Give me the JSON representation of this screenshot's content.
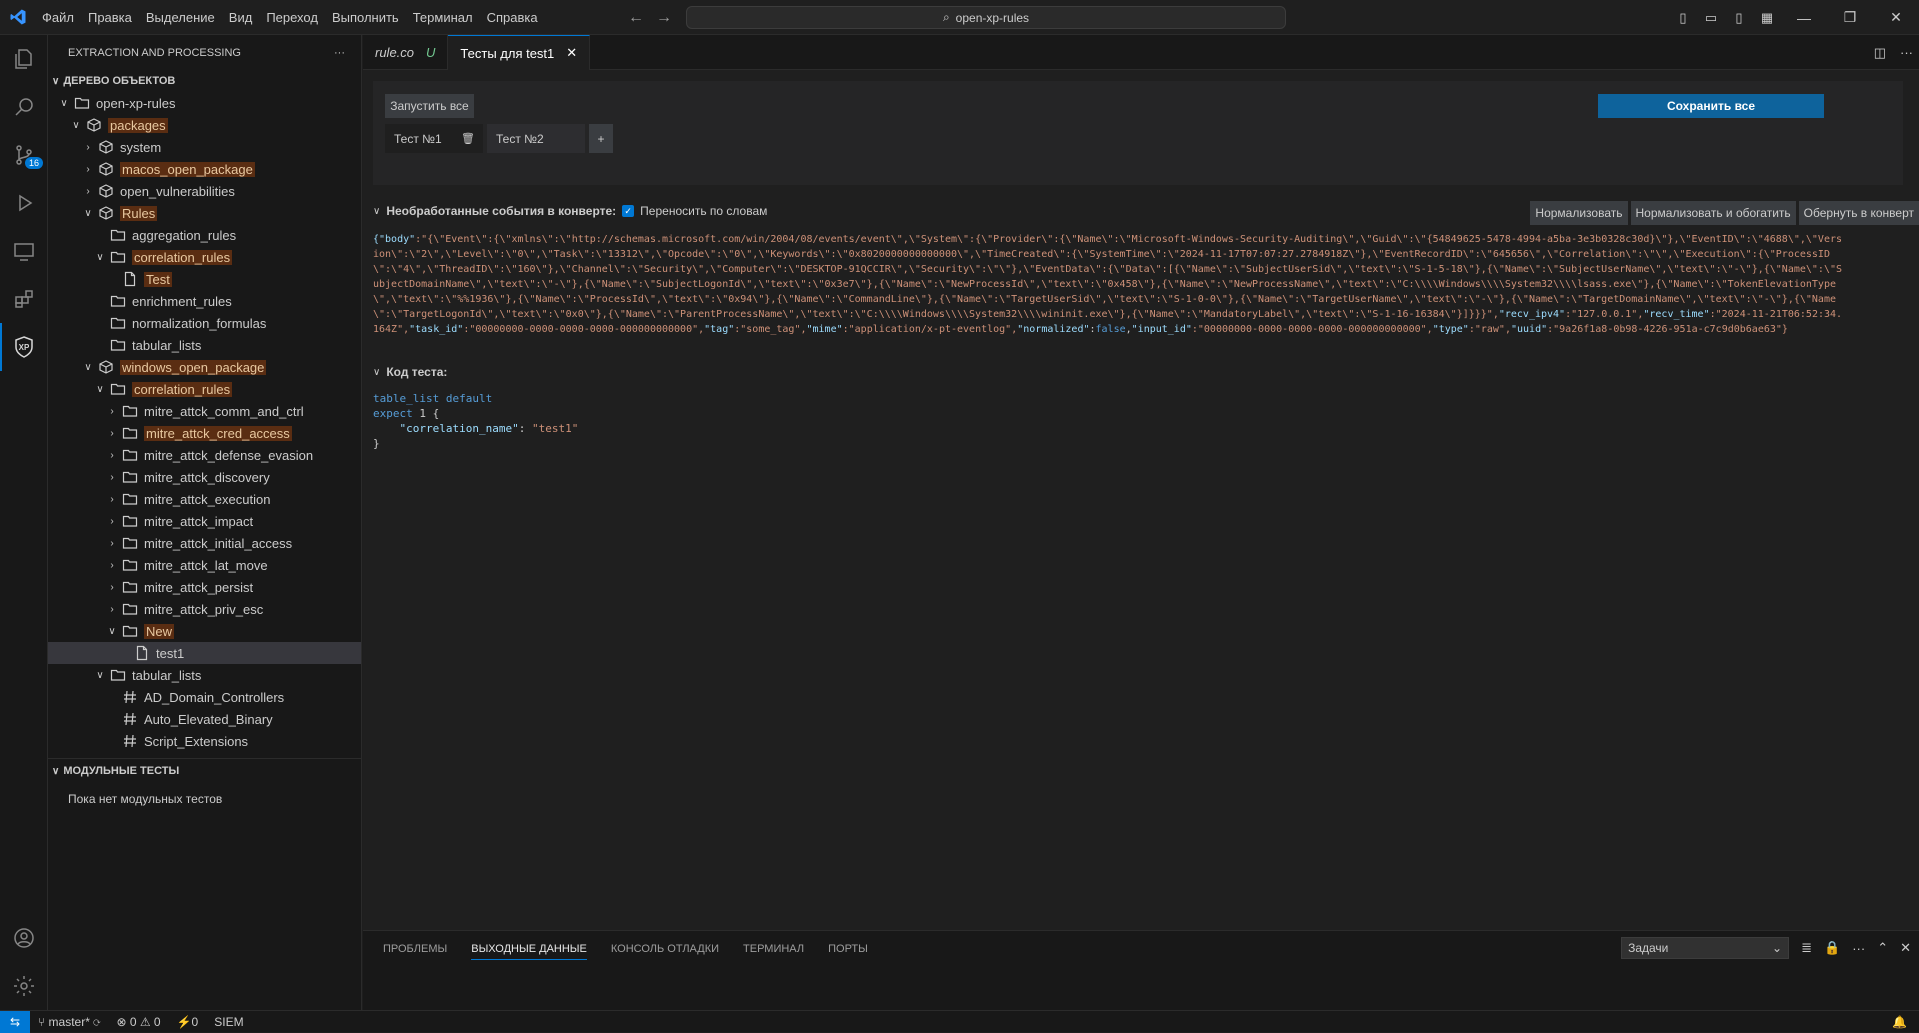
{
  "titlebar": {
    "menu": [
      "Файл",
      "Правка",
      "Выделение",
      "Вид",
      "Переход",
      "Выполнить",
      "Терминал",
      "Справка"
    ],
    "search": "open-xp-rules"
  },
  "activity": {
    "scm_badge": "16",
    "ext_label": "XP"
  },
  "sidebar": {
    "header": "EXTRACTION AND PROCESSING",
    "tree_title": "ДЕРЕВО ОБЪЕКТОВ",
    "tree": [
      {
        "label": "open-xp-rules",
        "level": 0,
        "type": "folder",
        "open": true
      },
      {
        "label": "packages",
        "level": 1,
        "type": "pkg",
        "open": true,
        "hl": true
      },
      {
        "label": "system",
        "level": 2,
        "type": "pkg",
        "open": false
      },
      {
        "label": "macos_open_package",
        "level": 2,
        "type": "pkg",
        "open": false,
        "hl": true
      },
      {
        "label": "open_vulnerabilities",
        "level": 2,
        "type": "pkg",
        "open": false
      },
      {
        "label": "Rules",
        "level": 2,
        "type": "pkg",
        "open": true,
        "hl": true
      },
      {
        "label": "aggregation_rules",
        "level": 3,
        "type": "folder",
        "leaf": true
      },
      {
        "label": "correlation_rules",
        "level": 3,
        "type": "folder",
        "open": true,
        "hl": true
      },
      {
        "label": "Test",
        "level": 4,
        "type": "file",
        "leaf": true,
        "hl": true
      },
      {
        "label": "enrichment_rules",
        "level": 3,
        "type": "folder",
        "leaf": true
      },
      {
        "label": "normalization_formulas",
        "level": 3,
        "type": "folder",
        "leaf": true
      },
      {
        "label": "tabular_lists",
        "level": 3,
        "type": "folder",
        "leaf": true
      },
      {
        "label": "windows_open_package",
        "level": 2,
        "type": "pkg",
        "open": true,
        "hl": true
      },
      {
        "label": "correlation_rules",
        "level": 3,
        "type": "folder",
        "open": true,
        "hl": true
      },
      {
        "label": "mitre_attck_comm_and_ctrl",
        "level": 4,
        "type": "folder",
        "open": false
      },
      {
        "label": "mitre_attck_cred_access",
        "level": 4,
        "type": "folder",
        "open": false,
        "hl": true
      },
      {
        "label": "mitre_attck_defense_evasion",
        "level": 4,
        "type": "folder",
        "open": false
      },
      {
        "label": "mitre_attck_discovery",
        "level": 4,
        "type": "folder",
        "open": false
      },
      {
        "label": "mitre_attck_execution",
        "level": 4,
        "type": "folder",
        "open": false
      },
      {
        "label": "mitre_attck_impact",
        "level": 4,
        "type": "folder",
        "open": false
      },
      {
        "label": "mitre_attck_initial_access",
        "level": 4,
        "type": "folder",
        "open": false
      },
      {
        "label": "mitre_attck_lat_move",
        "level": 4,
        "type": "folder",
        "open": false
      },
      {
        "label": "mitre_attck_persist",
        "level": 4,
        "type": "folder",
        "open": false
      },
      {
        "label": "mitre_attck_priv_esc",
        "level": 4,
        "type": "folder",
        "open": false
      },
      {
        "label": "New",
        "level": 4,
        "type": "folder",
        "open": true,
        "hl": true
      },
      {
        "label": "test1",
        "level": 5,
        "type": "file",
        "leaf": true,
        "selected": true
      },
      {
        "label": "tabular_lists",
        "level": 3,
        "type": "folder",
        "open": true
      },
      {
        "label": "AD_Domain_Controllers",
        "level": 4,
        "type": "hash",
        "leaf": true
      },
      {
        "label": "Auto_Elevated_Binary",
        "level": 4,
        "type": "hash",
        "leaf": true
      },
      {
        "label": "Script_Extensions",
        "level": 4,
        "type": "hash",
        "leaf": true
      }
    ],
    "unit_title": "МОДУЛЬНЫЕ ТЕСТЫ",
    "unit_empty": "Пока нет модульных тестов"
  },
  "tabs": [
    {
      "label": "rule.co",
      "mod": "U"
    },
    {
      "label": "Тесты для test1"
    }
  ],
  "tests": {
    "run_all": "Запустить все",
    "save_all": "Сохранить все",
    "test1": "Тест №1",
    "test2": "Тест №2",
    "add": "+"
  },
  "raw": {
    "title": "Необработанные события в конверте:",
    "wrap_label": "Переносить по словам",
    "buttons": [
      "Нормализовать",
      "Нормализовать и обогатить",
      "Обернуть в конверт"
    ]
  },
  "event_text": {
    "line1a": "{\"body\"",
    "line1b": ":\"{\\\"Event\\\":{\\\"xmlns\\\":\\\"http://schemas.microsoft.com/win/2004/08/events/event\\\",\\\"System\\\":{\\\"Provider\\\":{\\\"Name\\\":\\\"Microsoft-Windows-Security-Auditing\\\",\\\"Guid\\\":\\\"{54849625-5478-4994-a5ba-3e3b0328c30d}\\\"},\\\"EventID\\\":\\\"4688\\\",\\\"Version\\\":\\\"2\\\",\\\"Level\\\":\\\"0\\\",\\\"Task\\\":\\\"13312\\\",\\\"Opcode\\\":\\\"0\\\",\\\"Keywords\\\":\\\"0x8020000000000000\\\",\\\"TimeCreated\\\":{\\\"SystemTime\\\":\\\"2024-11-17T07:07:27.2784918Z\\\"},\\\"EventRecordID\\\":\\\"645656\\\",\\\"Correlation\\\":\\\"\\\",\\\"Execution\\\":{\\\"ProcessID\\\":\\\"4\\\",\\\"ThreadID\\\":\\\"160\\\"},\\\"Channel\\\":\\\"Security\\\",\\\"Computer\\\":\\\"DESKTOP-91QCCIR\\\",\\\"Security\\\":\\\"\\\"},\\\"EventData\\\":{\\\"Data\\\":[{\\\"Name\\\":\\\"SubjectUserSid\\\",\\\"text\\\":\\\"S-1-5-18\\\"},{\\\"Name\\\":\\\"SubjectUserName\\\",\\\"text\\\":\\\"-\\\"},{\\\"Name\\\":\\\"SubjectDomainName\\\",\\\"text\\\":\\\"-\\\"},{\\\"Name\\\":\\\"SubjectLogonId\\\",\\\"text\\\":\\\"0x3e7\\\"},{\\\"Name\\\":\\\"NewProcessId\\\",\\\"text\\\":\\\"0x458\\\"},{\\\"Name\\\":\\\"NewProcessName\\\",\\\"text\\\":\\\"C:\\\\\\\\Windows\\\\\\\\System32\\\\\\\\lsass.exe\\\"},{\\\"Name\\\":\\\"TokenElevationType\\\",\\\"text\\\":\\\"%%1936\\\"},{\\\"Name\\\":\\\"ProcessId\\\",\\\"text\\\":\\\"0x94\\\"},{\\\"Name\\\":\\\"CommandLine\\\"},{\\\"Name\\\":\\\"TargetUserSid\\\",\\\"text\\\":\\\"S-1-0-0\\\"},{\\\"Name\\\":\\\"TargetUserName\\\",\\\"text\\\":\\\"-\\\"},{\\\"Name\\\":\\\"TargetDomainName\\\",\\\"text\\\":\\\"-\\\"},{\\\"Name\\\":\\\"TargetLogonId\\\",\\\"text\\\":\\\"0x0\\\"},{\\\"Name\\\":\\\"ParentProcessName\\\",\\\"text\\\":\\\"C:\\\\\\\\Windows\\\\\\\\System32\\\\\\\\wininit.exe\\\"},{\\\"Name\\\":\\\"MandatoryLabel\\\",\\\"text\\\":\\\"S-1-16-16384\\\"}]}}}\",",
    "recv_ipv4_k": "\"recv_ipv4\"",
    "recv_ipv4_v": ":\"127.0.0.1\",",
    "recv_time_k": "\"recv_time\"",
    "recv_time_v": ":\"2024-11-21T06:52:34.164Z\",",
    "task_id_k": "\"task_id\"",
    "task_id_v": ":\"00000000-0000-0000-0000-000000000000\",",
    "tag_k": "\"tag\"",
    "tag_v": ":\"some_tag\",",
    "mime_k": "\"mime\"",
    "mime_v": ":\"application/x-pt-eventlog\",",
    "normalized_k": "\"normalized\"",
    "normalized_v": "false",
    "input_id_k": "\"input_id\"",
    "input_id_v": ":\"00000000-0000-0000-0000-000000000000\",",
    "type_k": "\"type\"",
    "type_v": ":\"raw\",",
    "uuid_k": "\"uuid\"",
    "uuid_v": ":\"9a26f1a8-0b98-4226-951a-c7c9d0b6ae63\"}"
  },
  "test_code": {
    "title": "Код теста:",
    "l1": "table_list default",
    "l2a": "expect",
    "l2b": " 1 {",
    "l3a": "    \"correlation_name\"",
    "l3b": ": ",
    "l3c": "\"test1\"",
    "l4": "}"
  },
  "panel": {
    "tabs": [
      "ПРОБЛЕМЫ",
      "ВЫХОДНЫЕ ДАННЫЕ",
      "КОНСОЛЬ ОТЛАДКИ",
      "ТЕРМИНАЛ",
      "ПОРТЫ"
    ],
    "active_tab": 1,
    "select": "Задачи"
  },
  "status": {
    "branch": "master*",
    "problems": "⊗ 0 ⚠ 0",
    "ports": "⚡0",
    "siem": "SIEM"
  }
}
